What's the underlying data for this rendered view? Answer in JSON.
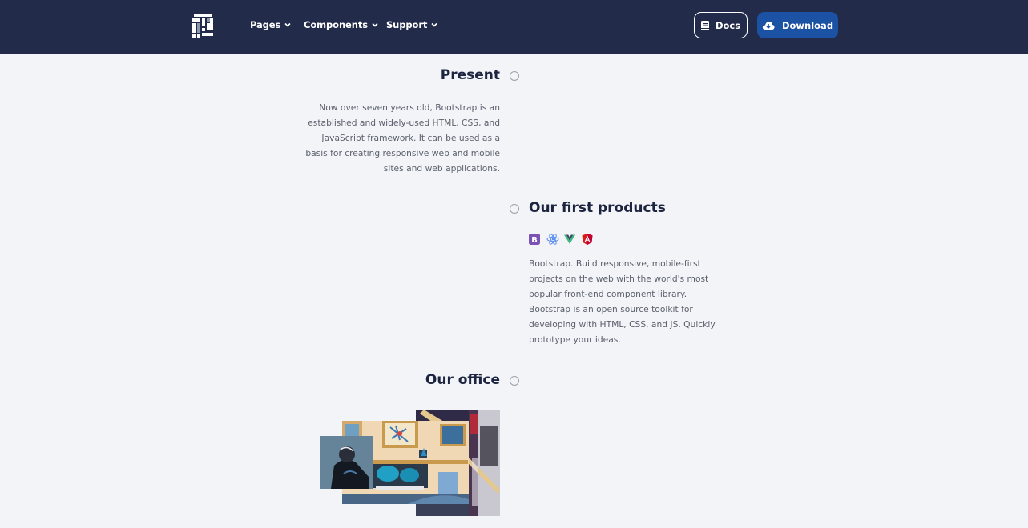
{
  "navbar": {
    "logo": "brand-logo",
    "items": [
      {
        "label": "Pages",
        "icon": "chevron-down-icon"
      },
      {
        "label": "Components",
        "icon": "chevron-down-icon"
      },
      {
        "label": "Support",
        "icon": "chevron-down-icon"
      }
    ],
    "docs_button": {
      "label": "Docs",
      "icon": "book-icon"
    },
    "download_button": {
      "label": "Download",
      "icon": "cloud-download-icon"
    },
    "colors": {
      "background": "#232b4a",
      "download": "#1b52a4"
    }
  },
  "timeline": {
    "entries": [
      {
        "title": "Present",
        "side": "left",
        "text": "Now over seven years old, Bootstrap is an established and widely-used HTML, CSS, and JavaScript framework. It can be used as a basis for creating responsive web and mobile sites and web applications."
      },
      {
        "title": "Our first products",
        "side": "right",
        "icons": [
          "bootstrap-icon",
          "react-icon",
          "vue-icon",
          "angular-icon"
        ],
        "text": "Bootstrap. Build responsive, mobile-first projects on the web with the world's most popular front-end component library. Bootstrap is an open source toolkit for developing with HTML, CSS, and JS. Quickly prototype your ideas."
      },
      {
        "title": "Our office",
        "side": "left",
        "image": "office-collage-image"
      }
    ],
    "icon_colors": {
      "bootstrap": "#7952b3",
      "react": "#61dafb",
      "vue": "#41b883",
      "angular": "#dd1b16"
    }
  }
}
